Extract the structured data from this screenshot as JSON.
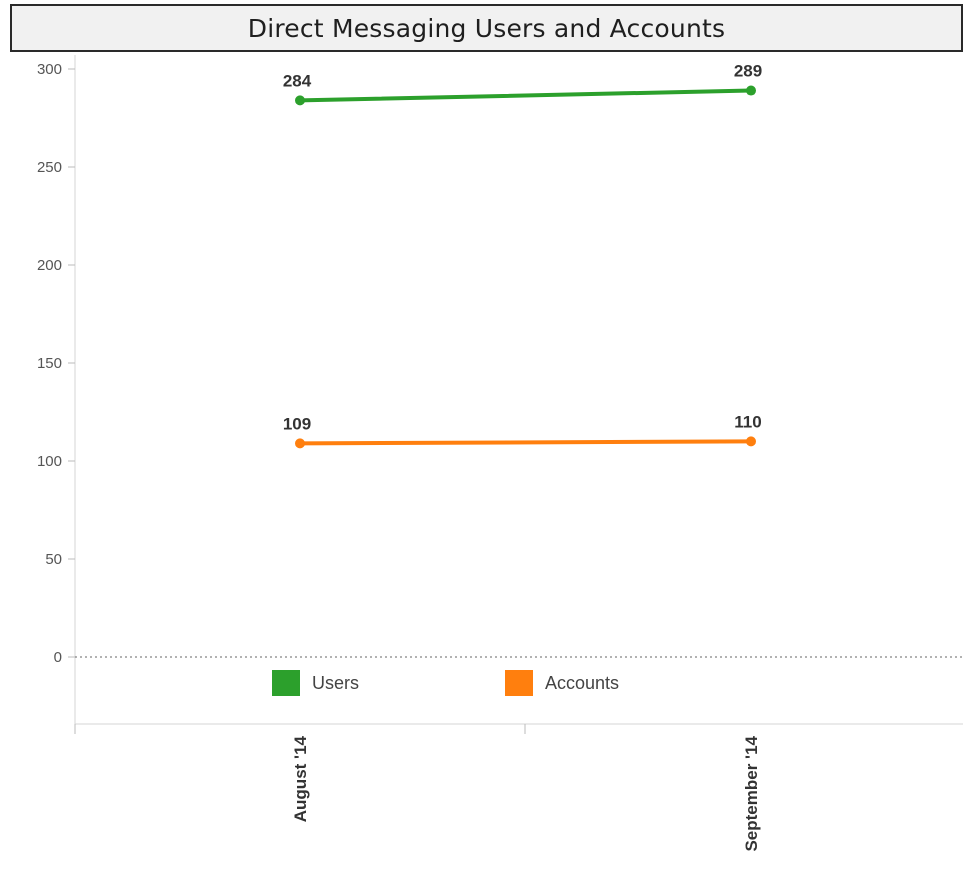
{
  "chart_data": {
    "type": "line",
    "title": "Direct Messaging Users and Accounts",
    "categories": [
      "August '14",
      "September '14"
    ],
    "series": [
      {
        "name": "Users",
        "values": [
          284,
          289
        ],
        "color": "#2ca02c"
      },
      {
        "name": "Accounts",
        "values": [
          109,
          110
        ],
        "color": "#ff7f0e"
      }
    ],
    "xlabel": "",
    "ylabel": "",
    "ylim": [
      -35,
      305
    ],
    "yticks": [
      0,
      50,
      100,
      150,
      200,
      250,
      300
    ],
    "zero_line": "dotted",
    "grid": false,
    "legend_position": "bottom"
  },
  "legend": {
    "items": [
      {
        "label": "Users",
        "color": "#2ca02c"
      },
      {
        "label": "Accounts",
        "color": "#ff7f0e"
      }
    ]
  }
}
